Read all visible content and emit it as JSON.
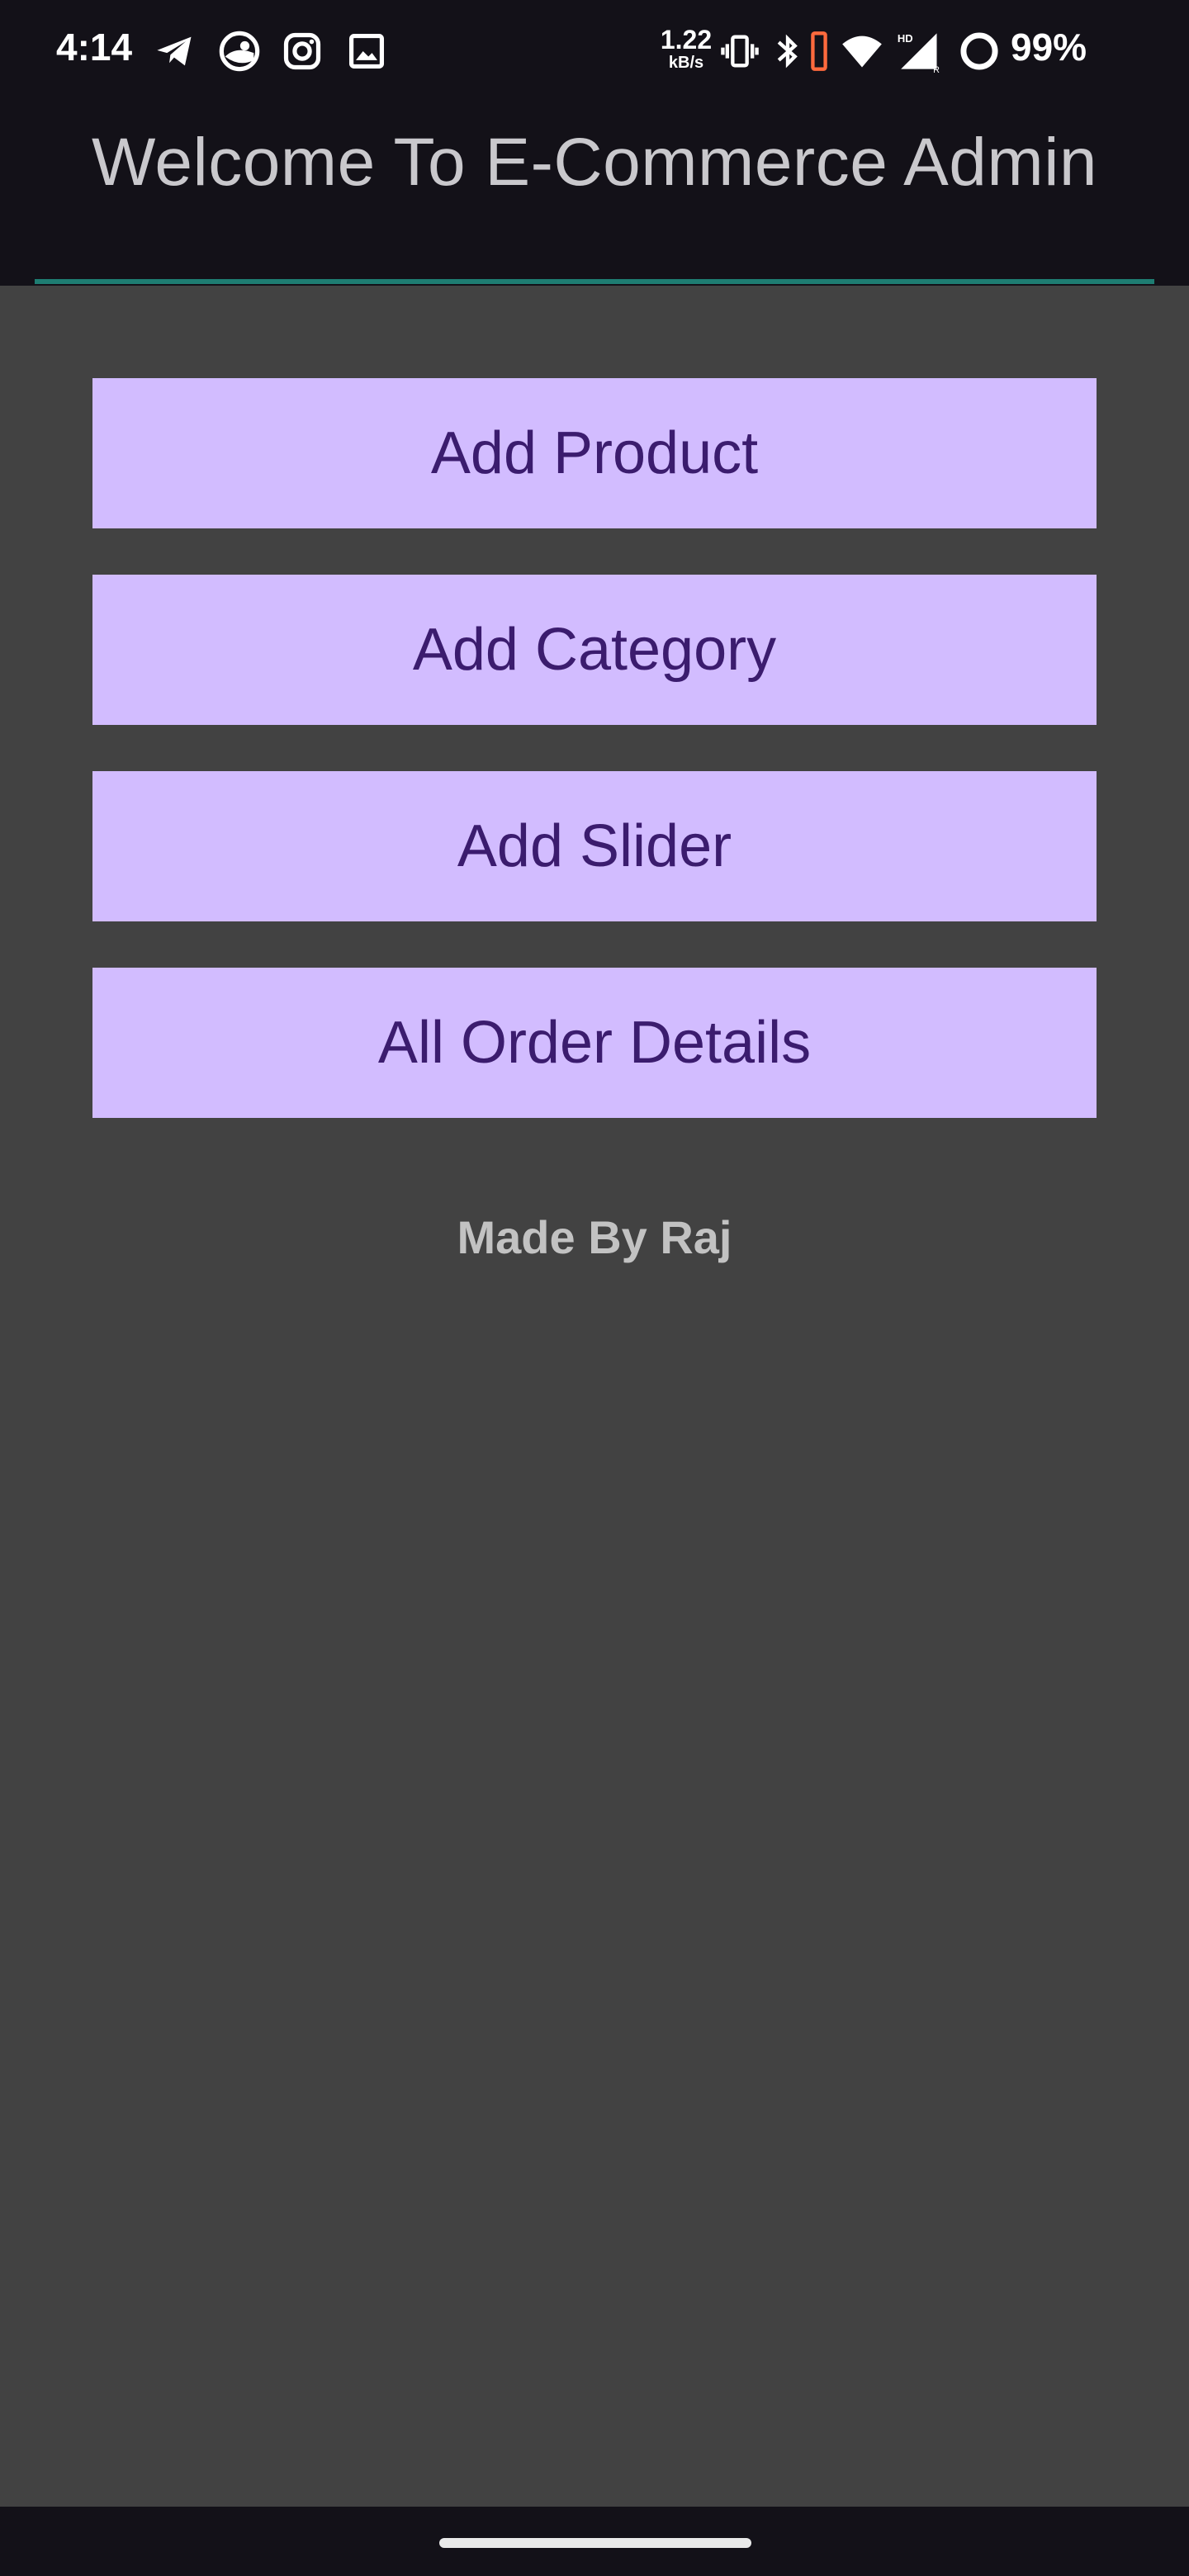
{
  "status_bar": {
    "time": "4:14",
    "net_speed_value": "1.22",
    "net_speed_unit": "kB/s",
    "battery_percent": "99%",
    "icons": [
      "telegram-icon",
      "steam-icon",
      "instagram-icon",
      "gallery-icon",
      "vibrate-icon",
      "bluetooth-icon",
      "wifi-icon",
      "signal-hd-icon",
      "battery-ring-icon"
    ],
    "accent_color": "#ff6a3d"
  },
  "header": {
    "title": "Welcome To E-Commerce Admin",
    "divider_color": "#1e7d72"
  },
  "actions": {
    "add_product": "Add Product",
    "add_category": "Add Category",
    "add_slider": "Add Slider",
    "all_order_details": "All Order Details"
  },
  "footer": {
    "text": "Made By Raj"
  },
  "colors": {
    "background": "#424242",
    "topbar": "#131118",
    "button_bg": "#d2bcff",
    "button_text": "#3b1c6e"
  }
}
